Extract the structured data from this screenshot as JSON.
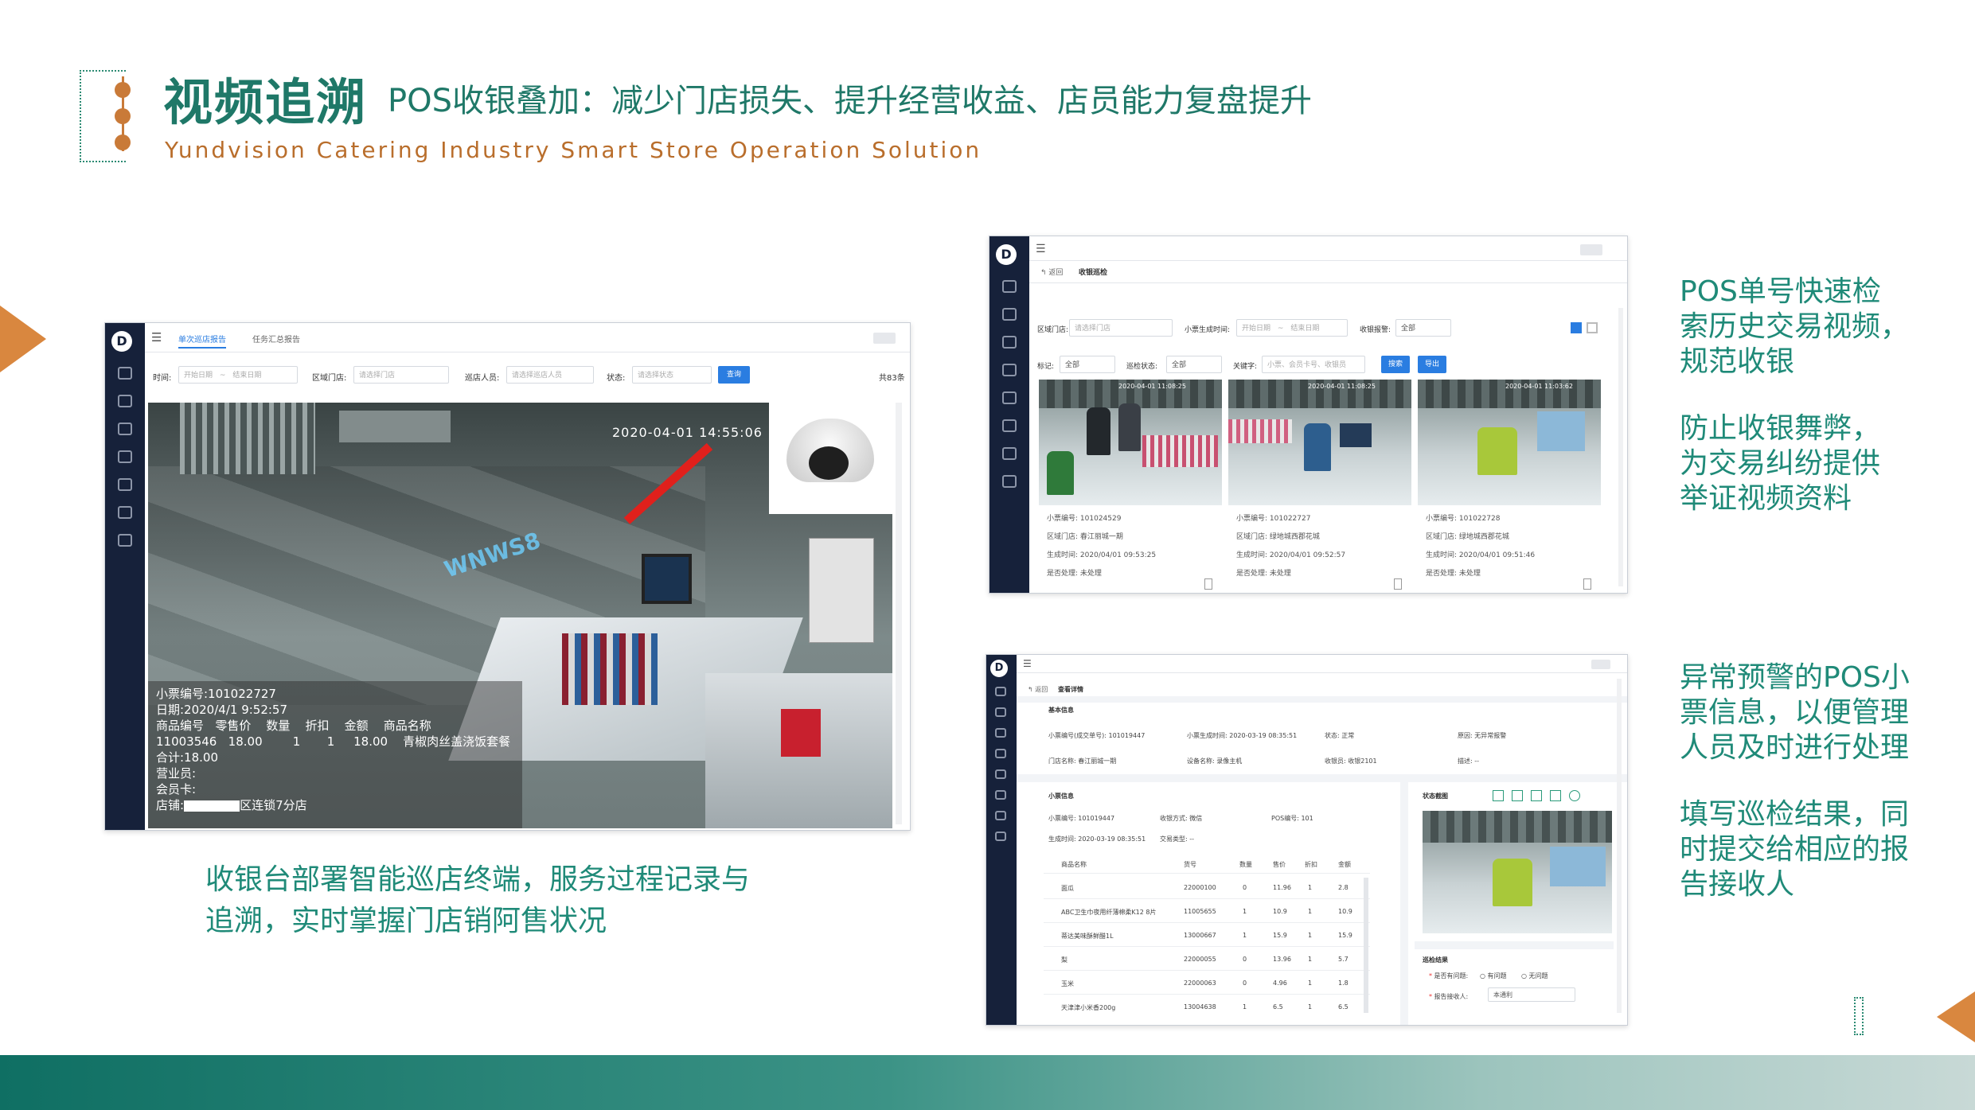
{
  "header": {
    "title": "视频追溯",
    "subtitle": "POS收银叠加：减少门店损失、提升经营收益、店员能力复盘提升",
    "english": "Yundvision Catering Industry Smart Store Operation Solution"
  },
  "caption": {
    "line1": "收银台部署智能巡店终端，服务过程记录与",
    "line2": "追溯，实时掌握门店销阿售状况"
  },
  "right_text": {
    "block1": [
      "POS单号快速检",
      "索历史交易视频，",
      "规范收银"
    ],
    "block2": [
      "防止收银舞弊，",
      "为交易纠纷提供",
      "举证视频资料"
    ],
    "block3": [
      "异常预警的POS小",
      "票信息，以便管理",
      "人员及时进行处理"
    ],
    "block4": [
      "填写巡检结果，同",
      "时提交给相应的报",
      "告接收人"
    ]
  },
  "shot1": {
    "tabs": [
      "单次巡店报告",
      "任务汇总报告"
    ],
    "filters": {
      "time_label": "时间:",
      "time_start": "开始日期",
      "time_sep": "~",
      "time_end": "结束日期",
      "store_label": "区域门店:",
      "store_ph": "请选择门店",
      "staff_label": "巡店人员:",
      "staff_ph": "请选择巡店人员",
      "status_label": "状态:",
      "status_ph": "请选择状态",
      "search_btn": "查询",
      "total": "共83条"
    },
    "timestamp": "2020-04-01 14:55:06",
    "receipt": {
      "no": "小票编号:101022727",
      "date": "日期:2020/4/1 9:52:57",
      "headers": [
        "商品编号",
        "零售价",
        "数量",
        "折扣",
        "金额",
        "商品名称"
      ],
      "row": [
        "11003546",
        "18.00",
        "1",
        "1",
        "18.00",
        "青椒肉丝盖浇饭套餐"
      ],
      "total": "合计:18.00",
      "clerk": "营业员:",
      "member": "会员卡:",
      "store": "店铺:",
      "store_suffix": "区连锁7分店"
    }
  },
  "shot2": {
    "back": "返回",
    "page": "收银巡检",
    "filters": {
      "store_label": "区域门店:",
      "store_ph": "请选择门店",
      "gen_label": "小票生成时间:",
      "gen_start": "开始日期",
      "gen_sep": "~",
      "gen_end": "结束日期",
      "alarm_label": "收银报警:",
      "alarm_val": "全部",
      "mark_label": "标记:",
      "mark_val": "全部",
      "insp_label": "巡检状态:",
      "insp_val": "全部",
      "kw_label": "关键字:",
      "kw_ph": "小票、会员卡号、收银员",
      "search_btn": "搜索",
      "export_btn": "导出"
    },
    "cards": [
      {
        "no_label": "小票编号:",
        "no": "101024529",
        "store_label": "区域门店:",
        "store": "春江丽城一期",
        "time_label": "生成时间:",
        "time": "2020/04/01 09:53:25",
        "state_label": "是否处理:",
        "state": "未处理",
        "ts": "2020-04-01 11:08:25"
      },
      {
        "no_label": "小票编号:",
        "no": "101022727",
        "store_label": "区域门店:",
        "store": "绿地城西郡花城",
        "time_label": "生成时间:",
        "time": "2020/04/01 09:52:57",
        "state_label": "是否处理:",
        "state": "未处理",
        "ts": "2020-04-01 11:08:25"
      },
      {
        "no_label": "小票编号:",
        "no": "101022728",
        "store_label": "区域门店:",
        "store": "绿地城西郡花城",
        "time_label": "生成时间:",
        "time": "2020/04/01 09:51:46",
        "state_label": "是否处理:",
        "state": "未处理",
        "ts": "2020-04-01 11:03:62"
      }
    ]
  },
  "shot3": {
    "back": "返回",
    "page": "查看详情",
    "basic": {
      "title": "基本信息",
      "fields": [
        [
          "小票编号(成交单号):",
          "101019447"
        ],
        [
          "小票生成时间:",
          "2020-03-19 08:35:51"
        ],
        [
          "状态:",
          "正常"
        ],
        [
          "原因:",
          "无异常报警"
        ],
        [
          "门店名称:",
          "春江丽城一期"
        ],
        [
          "设备名称:",
          "录像主机"
        ],
        [
          "收银员:",
          "收银2101"
        ],
        [
          "描述:",
          "--"
        ]
      ]
    },
    "receipt": {
      "title": "小票信息",
      "fields": [
        [
          "小票编号:",
          "101019447"
        ],
        [
          "收银方式:",
          "微信"
        ],
        [
          "POS编号:",
          "101"
        ],
        [
          "生成时间:",
          "2020-03-19 08:35:51"
        ],
        [
          "交易类型:",
          "--"
        ]
      ],
      "headers": [
        "商品名称",
        "货号",
        "数量",
        "售价",
        "折扣",
        "金额"
      ],
      "rows": [
        [
          "面瓜",
          "22000100",
          "0",
          "11.96",
          "1",
          "2.8"
        ],
        [
          "ABC卫生巾夜用纤薄棉柔K12 8片",
          "11005655",
          "1",
          "10.9",
          "1",
          "10.9"
        ],
        [
          "蒂达美味酥鲜醋1L",
          "13000667",
          "1",
          "15.9",
          "1",
          "15.9"
        ],
        [
          "梨",
          "22000055",
          "0",
          "13.96",
          "1",
          "5.7"
        ],
        [
          "玉米",
          "22000063",
          "0",
          "4.96",
          "1",
          "1.8"
        ],
        [
          "天津津小米香200g",
          "13004638",
          "1",
          "6.5",
          "1",
          "6.5"
        ]
      ]
    },
    "status_title": "状态截图",
    "result": {
      "title": "巡检结果",
      "q1": "是否有问题:",
      "opt1": "有问题",
      "opt2": "无问题",
      "q2": "报告接收人:",
      "recv": "本通利"
    }
  },
  "colors": {
    "teal": "#1f7868",
    "orange": "#c97a38",
    "sidebar": "#16213a",
    "blue": "#2a7de1"
  }
}
